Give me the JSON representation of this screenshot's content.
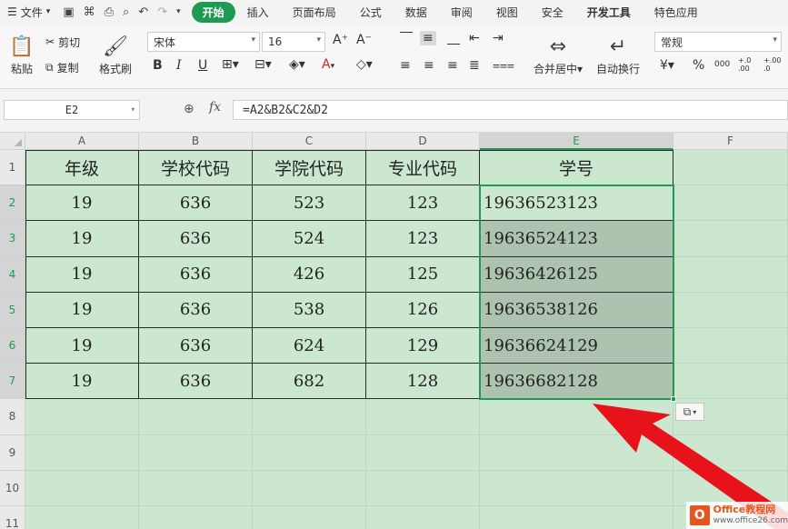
{
  "menubar": {
    "file_label": "文件",
    "tabs": [
      {
        "label": "开始",
        "active": true
      },
      {
        "label": "插入"
      },
      {
        "label": "页面布局"
      },
      {
        "label": "公式"
      },
      {
        "label": "数据"
      },
      {
        "label": "审阅"
      },
      {
        "label": "视图"
      },
      {
        "label": "安全"
      },
      {
        "label": "开发工具"
      },
      {
        "label": "特色应用"
      }
    ]
  },
  "ribbon": {
    "paste": "粘贴",
    "cut": "剪切",
    "copy": "复制",
    "format_painter": "格式刷",
    "font_name": "宋体",
    "font_size": "16",
    "merge_center": "合并居中",
    "wrap_text": "自动换行",
    "number_format": "常规",
    "percent": "%",
    "thousands": "000",
    "dec_inc": "+.0 .00",
    "dec_dec": "+.00 .0"
  },
  "formula_bar": {
    "name_box": "E2",
    "fx_label": "fx",
    "formula": "=A2&B2&C2&D2"
  },
  "sheet": {
    "columns": [
      "A",
      "B",
      "C",
      "D",
      "E",
      "F"
    ],
    "rows": [
      "1",
      "2",
      "3",
      "4",
      "5",
      "6",
      "7",
      "8",
      "9",
      "10",
      "11"
    ],
    "header": [
      "年级",
      "学校代码",
      "学院代码",
      "专业代码",
      "学号"
    ],
    "data": [
      [
        "19",
        "636",
        "523",
        "123",
        "19636523123"
      ],
      [
        "19",
        "636",
        "524",
        "123",
        "19636524123"
      ],
      [
        "19",
        "636",
        "426",
        "125",
        "19636426125"
      ],
      [
        "19",
        "636",
        "538",
        "126",
        "19636538126"
      ],
      [
        "19",
        "636",
        "624",
        "129",
        "19636624129"
      ],
      [
        "19",
        "636",
        "682",
        "128",
        "19636682128"
      ]
    ],
    "selected_column": "E",
    "active_cell": "E2",
    "selection_range": "E2:E7"
  },
  "watermark": {
    "brand": "Office教程网",
    "url": "www.office26.com"
  },
  "colors": {
    "accent": "#1f9a52",
    "sheet_bg": "#cce7cf",
    "selection_shade": "#aec3af",
    "arrow": "#e8121a"
  }
}
